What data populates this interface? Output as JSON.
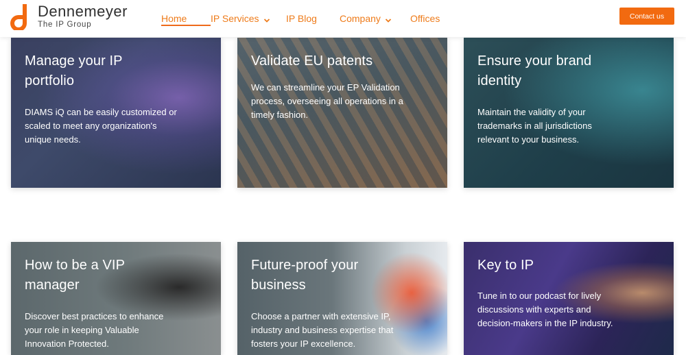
{
  "brand": {
    "name": "Dennemeyer",
    "tagline": "The IP Group",
    "accent": "#f26a10"
  },
  "nav": {
    "items": [
      {
        "label": "Home",
        "active": true,
        "dropdown": false
      },
      {
        "label": "IP Services",
        "active": false,
        "dropdown": true
      },
      {
        "label": "IP Blog",
        "active": false,
        "dropdown": false
      },
      {
        "label": "Company",
        "active": false,
        "dropdown": true
      },
      {
        "label": "Offices",
        "active": false,
        "dropdown": false
      }
    ],
    "contact_label": "Contact us"
  },
  "cards": [
    {
      "title_line1": "Manage your IP",
      "title_line2": "portfolio",
      "desc_line1": "DIAMS iQ can be easily customized or",
      "desc_line2": "scaled to meet any organization's",
      "desc_line3": "unique needs."
    },
    {
      "title_line1": "Validate EU patents",
      "title_line2": "",
      "desc_line1": "We can streamline your EP Validation",
      "desc_line2": "process, overseeing all operations in a",
      "desc_line3": "timely fashion."
    },
    {
      "title_line1": "Ensure your brand",
      "title_line2": "identity",
      "desc_line1": "Maintain the validity of your",
      "desc_line2": "trademarks in all jurisdictions",
      "desc_line3": "relevant to your business."
    },
    {
      "title_line1": "How to be a VIP",
      "title_line2": "manager",
      "desc_line1": "Discover best practices to enhance",
      "desc_line2": "your role in keeping Valuable",
      "desc_line3": "Innovation Protected."
    },
    {
      "title_line1": "Future-proof your",
      "title_line2": "business",
      "desc_line1": "Choose a partner with extensive IP,",
      "desc_line2": "industry and business expertise that",
      "desc_line3": "fosters your IP excellence."
    },
    {
      "title_line1": "Key to IP",
      "title_line2": "",
      "desc_line1": "Tune in to our podcast for lively",
      "desc_line2": "discussions with experts and",
      "desc_line3": "decision-makers in the IP industry."
    }
  ]
}
